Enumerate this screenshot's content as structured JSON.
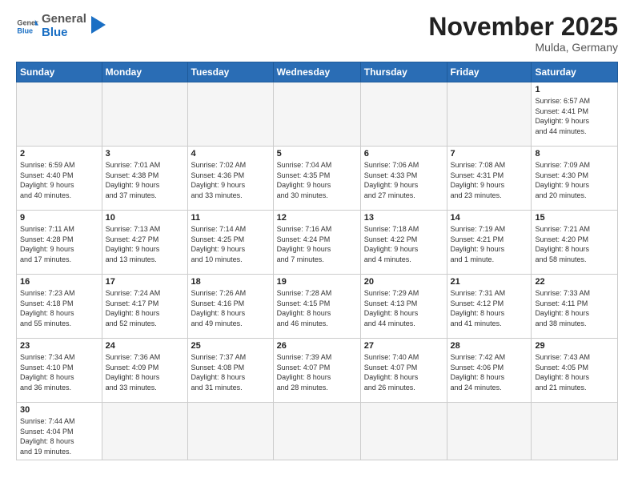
{
  "logo": {
    "text_general": "General",
    "text_blue": "Blue"
  },
  "title": "November 2025",
  "subtitle": "Mulda, Germany",
  "weekdays": [
    "Sunday",
    "Monday",
    "Tuesday",
    "Wednesday",
    "Thursday",
    "Friday",
    "Saturday"
  ],
  "weeks": [
    [
      {
        "day": "",
        "empty": true
      },
      {
        "day": "",
        "empty": true
      },
      {
        "day": "",
        "empty": true
      },
      {
        "day": "",
        "empty": true
      },
      {
        "day": "",
        "empty": true
      },
      {
        "day": "",
        "empty": true
      },
      {
        "day": "1",
        "info": "Sunrise: 6:57 AM\nSunset: 4:41 PM\nDaylight: 9 hours\nand 44 minutes."
      }
    ],
    [
      {
        "day": "2",
        "info": "Sunrise: 6:59 AM\nSunset: 4:40 PM\nDaylight: 9 hours\nand 40 minutes."
      },
      {
        "day": "3",
        "info": "Sunrise: 7:01 AM\nSunset: 4:38 PM\nDaylight: 9 hours\nand 37 minutes."
      },
      {
        "day": "4",
        "info": "Sunrise: 7:02 AM\nSunset: 4:36 PM\nDaylight: 9 hours\nand 33 minutes."
      },
      {
        "day": "5",
        "info": "Sunrise: 7:04 AM\nSunset: 4:35 PM\nDaylight: 9 hours\nand 30 minutes."
      },
      {
        "day": "6",
        "info": "Sunrise: 7:06 AM\nSunset: 4:33 PM\nDaylight: 9 hours\nand 27 minutes."
      },
      {
        "day": "7",
        "info": "Sunrise: 7:08 AM\nSunset: 4:31 PM\nDaylight: 9 hours\nand 23 minutes."
      },
      {
        "day": "8",
        "info": "Sunrise: 7:09 AM\nSunset: 4:30 PM\nDaylight: 9 hours\nand 20 minutes."
      }
    ],
    [
      {
        "day": "9",
        "info": "Sunrise: 7:11 AM\nSunset: 4:28 PM\nDaylight: 9 hours\nand 17 minutes."
      },
      {
        "day": "10",
        "info": "Sunrise: 7:13 AM\nSunset: 4:27 PM\nDaylight: 9 hours\nand 13 minutes."
      },
      {
        "day": "11",
        "info": "Sunrise: 7:14 AM\nSunset: 4:25 PM\nDaylight: 9 hours\nand 10 minutes."
      },
      {
        "day": "12",
        "info": "Sunrise: 7:16 AM\nSunset: 4:24 PM\nDaylight: 9 hours\nand 7 minutes."
      },
      {
        "day": "13",
        "info": "Sunrise: 7:18 AM\nSunset: 4:22 PM\nDaylight: 9 hours\nand 4 minutes."
      },
      {
        "day": "14",
        "info": "Sunrise: 7:19 AM\nSunset: 4:21 PM\nDaylight: 9 hours\nand 1 minute."
      },
      {
        "day": "15",
        "info": "Sunrise: 7:21 AM\nSunset: 4:20 PM\nDaylight: 8 hours\nand 58 minutes."
      }
    ],
    [
      {
        "day": "16",
        "info": "Sunrise: 7:23 AM\nSunset: 4:18 PM\nDaylight: 8 hours\nand 55 minutes."
      },
      {
        "day": "17",
        "info": "Sunrise: 7:24 AM\nSunset: 4:17 PM\nDaylight: 8 hours\nand 52 minutes."
      },
      {
        "day": "18",
        "info": "Sunrise: 7:26 AM\nSunset: 4:16 PM\nDaylight: 8 hours\nand 49 minutes."
      },
      {
        "day": "19",
        "info": "Sunrise: 7:28 AM\nSunset: 4:15 PM\nDaylight: 8 hours\nand 46 minutes."
      },
      {
        "day": "20",
        "info": "Sunrise: 7:29 AM\nSunset: 4:13 PM\nDaylight: 8 hours\nand 44 minutes."
      },
      {
        "day": "21",
        "info": "Sunrise: 7:31 AM\nSunset: 4:12 PM\nDaylight: 8 hours\nand 41 minutes."
      },
      {
        "day": "22",
        "info": "Sunrise: 7:33 AM\nSunset: 4:11 PM\nDaylight: 8 hours\nand 38 minutes."
      }
    ],
    [
      {
        "day": "23",
        "info": "Sunrise: 7:34 AM\nSunset: 4:10 PM\nDaylight: 8 hours\nand 36 minutes."
      },
      {
        "day": "24",
        "info": "Sunrise: 7:36 AM\nSunset: 4:09 PM\nDaylight: 8 hours\nand 33 minutes."
      },
      {
        "day": "25",
        "info": "Sunrise: 7:37 AM\nSunset: 4:08 PM\nDaylight: 8 hours\nand 31 minutes."
      },
      {
        "day": "26",
        "info": "Sunrise: 7:39 AM\nSunset: 4:07 PM\nDaylight: 8 hours\nand 28 minutes."
      },
      {
        "day": "27",
        "info": "Sunrise: 7:40 AM\nSunset: 4:07 PM\nDaylight: 8 hours\nand 26 minutes."
      },
      {
        "day": "28",
        "info": "Sunrise: 7:42 AM\nSunset: 4:06 PM\nDaylight: 8 hours\nand 24 minutes."
      },
      {
        "day": "29",
        "info": "Sunrise: 7:43 AM\nSunset: 4:05 PM\nDaylight: 8 hours\nand 21 minutes."
      }
    ],
    [
      {
        "day": "30",
        "info": "Sunrise: 7:44 AM\nSunset: 4:04 PM\nDaylight: 8 hours\nand 19 minutes.",
        "last": true
      },
      {
        "day": "",
        "empty": true,
        "last": true
      },
      {
        "day": "",
        "empty": true,
        "last": true
      },
      {
        "day": "",
        "empty": true,
        "last": true
      },
      {
        "day": "",
        "empty": true,
        "last": true
      },
      {
        "day": "",
        "empty": true,
        "last": true
      },
      {
        "day": "",
        "empty": true,
        "last": true
      }
    ]
  ]
}
